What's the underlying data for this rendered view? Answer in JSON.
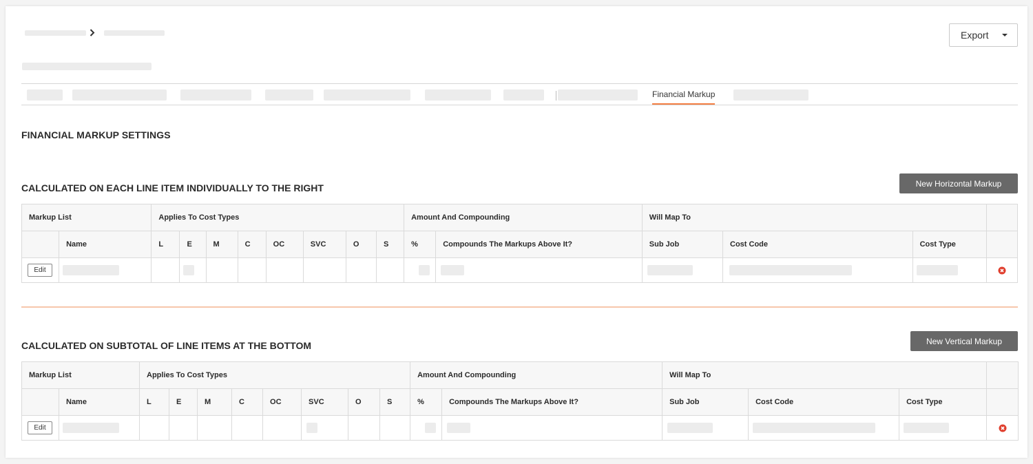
{
  "header": {
    "export_label": "Export"
  },
  "tabs": {
    "active_label": "Financial Markup"
  },
  "page": {
    "title": "FINANCIAL MARKUP SETTINGS"
  },
  "sections": [
    {
      "title": "CALCULATED ON EACH LINE ITEM INDIVIDUALLY TO THE RIGHT",
      "button": "New Horizontal Markup",
      "groups": {
        "markup_list": "Markup List",
        "applies": "Applies To Cost Types",
        "amount": "Amount And Compounding",
        "map": "Will Map To"
      },
      "columns": {
        "name": "Name",
        "l": "L",
        "e": "E",
        "m": "M",
        "c": "C",
        "oc": "OC",
        "svc": "SVC",
        "o": "O",
        "s": "S",
        "pct": "%",
        "compounds": "Compounds The Markups Above It?",
        "sub_job": "Sub Job",
        "cost_code": "Cost Code",
        "cost_type": "Cost Type"
      },
      "row": {
        "edit": "Edit"
      }
    },
    {
      "title": "CALCULATED ON SUBTOTAL OF LINE ITEMS AT THE BOTTOM",
      "button": "New Vertical Markup",
      "groups": {
        "markup_list": "Markup List",
        "applies": "Applies To Cost Types",
        "amount": "Amount And Compounding",
        "map": "Will Map To"
      },
      "columns": {
        "name": "Name",
        "l": "L",
        "e": "E",
        "m": "M",
        "c": "C",
        "oc": "OC",
        "svc": "SVC",
        "o": "O",
        "s": "S",
        "pct": "%",
        "compounds": "Compounds The Markups Above It?",
        "sub_job": "Sub Job",
        "cost_code": "Cost Code",
        "cost_type": "Cost Type"
      },
      "row": {
        "edit": "Edit"
      }
    }
  ],
  "colors": {
    "accent": "#f47e42",
    "button_dark": "#686868",
    "delete": "#e03e2d"
  },
  "icons": {
    "breadcrumb_separator": "chevron-right-icon",
    "export_caret": "caret-down-icon",
    "delete": "remove-circle-icon"
  }
}
